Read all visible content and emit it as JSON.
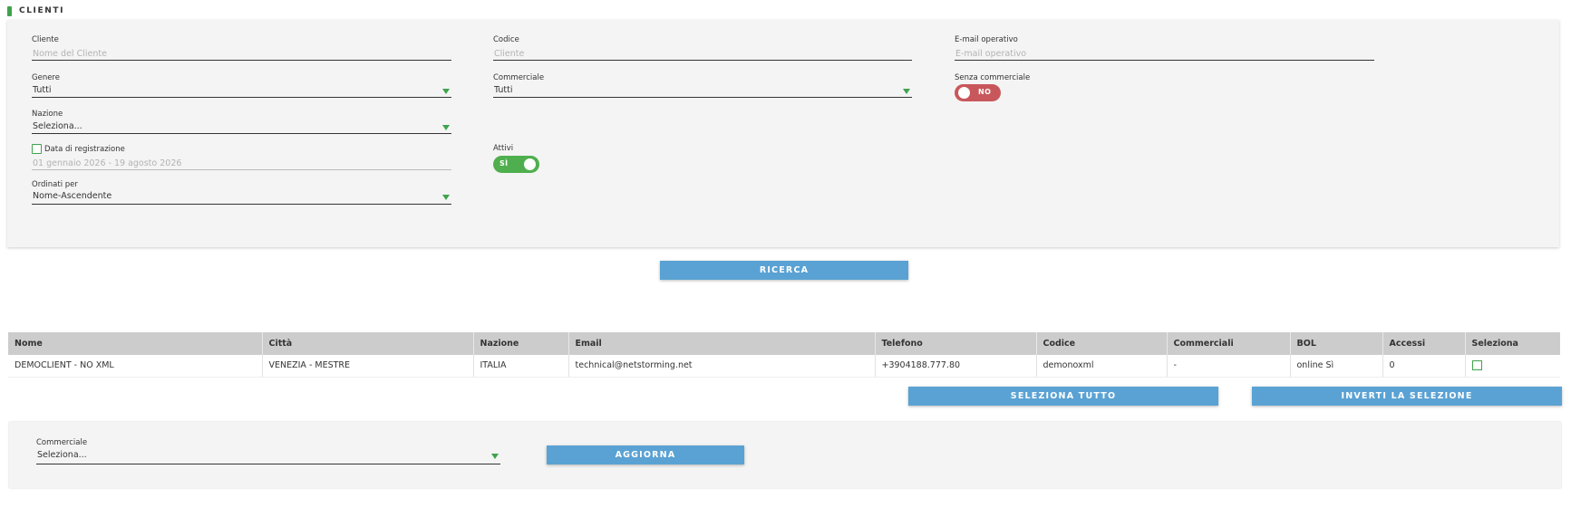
{
  "header": {
    "title": "CLIENTI"
  },
  "filters": {
    "cliente": {
      "label": "Cliente",
      "placeholder": "Nome del Cliente"
    },
    "codice": {
      "label": "Codice",
      "placeholder": "Cliente"
    },
    "email_operativo": {
      "label": "E-mail operativo",
      "placeholder": "E-mail operativo"
    },
    "genere": {
      "label": "Genere",
      "value": "Tutti"
    },
    "commerciale": {
      "label": "Commerciale",
      "value": "Tutti"
    },
    "senza_commerciale": {
      "label": "Senza commerciale",
      "state": "NO"
    },
    "nazione": {
      "label": "Nazione",
      "value": "Seleziona..."
    },
    "data_registrazione": {
      "label": "Data di registrazione",
      "value": "01 gennaio 2026 - 19 agosto 2026",
      "checked": false
    },
    "attivi": {
      "label": "Attivi",
      "state": "SÌ"
    },
    "ordinati_per": {
      "label": "Ordinati per",
      "value": "Nome-Ascendente"
    }
  },
  "buttons": {
    "ricerca": "RICERCA",
    "seleziona_tutto": "SELEZIONA TUTTO",
    "inverti_selezione": "INVERTI LA SELEZIONE",
    "aggiorna": "AGGIORNA"
  },
  "table": {
    "columns": [
      "Nome",
      "Città",
      "Nazione",
      "Email",
      "Telefono",
      "Codice",
      "Commerciali",
      "BOL",
      "Accessi",
      "Seleziona"
    ],
    "rows": [
      {
        "nome": "DEMOCLIENT - NO XML",
        "citta": "VENEZIA - MESTRE",
        "nazione": "ITALIA",
        "email": "technical@netstorming.net",
        "telefono": "+3904188.777.80",
        "codice": "demonoxml",
        "commerciali": "-",
        "bol": "online Sì",
        "accessi": "0",
        "seleziona": false
      }
    ]
  },
  "bottom": {
    "commerciale": {
      "label": "Commerciale",
      "value": "Seleziona..."
    }
  },
  "colors": {
    "accent_green": "#3fa34d",
    "button_blue": "#5aa2d3",
    "toggle_off_red": "#c8575b",
    "toggle_on_green": "#4faf4e"
  }
}
